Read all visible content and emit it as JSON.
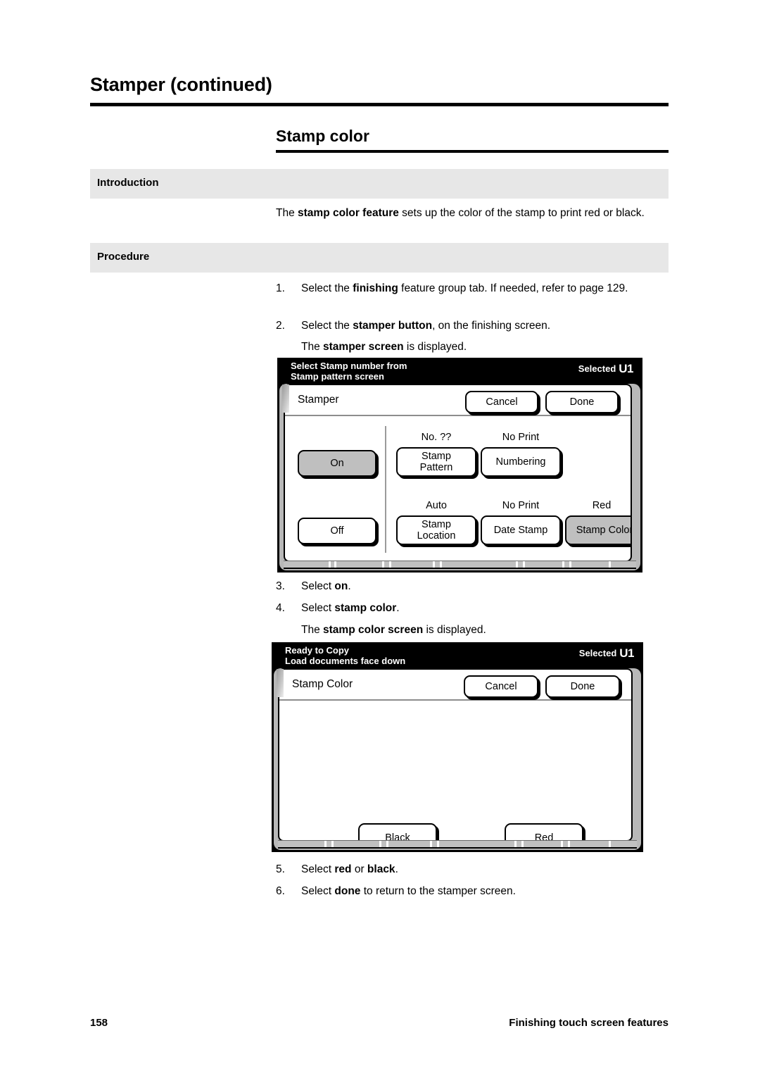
{
  "header": {
    "chapter_title": "Stamper (continued)",
    "section_title": "Stamp color"
  },
  "bands": {
    "introduction": "Introduction",
    "procedure": "Procedure"
  },
  "introduction": {
    "text_before": "The ",
    "text_bold": "stamp color feature",
    "text_after": " sets up the color of the stamp to print red or black."
  },
  "steps": [
    {
      "num": "1.",
      "parts": [
        {
          "t": "Select the ",
          "b": false
        },
        {
          "t": "finishing",
          "b": true
        },
        {
          "t": " feature group tab.  If needed, refer to page 129.",
          "b": false
        }
      ]
    },
    {
      "num": "2.",
      "parts": [
        {
          "t": "Select the ",
          "b": false
        },
        {
          "t": "stamper button",
          "b": true
        },
        {
          "t": ", on the finishing screen.",
          "b": false
        }
      ]
    },
    {
      "num": "3.",
      "parts": [
        {
          "t": "Select ",
          "b": false
        },
        {
          "t": "on",
          "b": true
        },
        {
          "t": ".",
          "b": false
        }
      ]
    },
    {
      "num": "4.",
      "parts": [
        {
          "t": "Select ",
          "b": false
        },
        {
          "t": "stamp color",
          "b": true
        },
        {
          "t": ".",
          "b": false
        }
      ]
    },
    {
      "num": "5.",
      "parts": [
        {
          "t": "Select ",
          "b": false
        },
        {
          "t": "red",
          "b": true
        },
        {
          "t": " or ",
          "b": false
        },
        {
          "t": "black",
          "b": true
        },
        {
          "t": ".",
          "b": false
        }
      ]
    },
    {
      "num": "6.",
      "parts": [
        {
          "t": "Select ",
          "b": false
        },
        {
          "t": "done",
          "b": true
        },
        {
          "t": " to return to the stamper screen.",
          "b": false
        }
      ]
    }
  ],
  "substeps": {
    "after_step2": [
      {
        "t": "The ",
        "b": false
      },
      {
        "t": "stamper screen",
        "b": true
      },
      {
        "t": " is displayed.",
        "b": false
      }
    ],
    "after_step4": [
      {
        "t": "The ",
        "b": false
      },
      {
        "t": "stamp color screen",
        "b": true
      },
      {
        "t": " is displayed.",
        "b": false
      }
    ]
  },
  "panel_stamper": {
    "status_line1": "Select Stamp number from",
    "status_line2": "Stamp pattern screen",
    "status_selected_label": "Selected",
    "status_selected_value": "U1",
    "title": "Stamper",
    "cancel_label": "Cancel",
    "done_label": "Done",
    "on_label": "On",
    "off_label": "Off",
    "buttons_row1": [
      {
        "caption": "No. ??",
        "label_line1": "Stamp",
        "label_line2": "Pattern",
        "selected": false
      },
      {
        "caption": "No Print",
        "label_line1": "Numbering",
        "label_line2": "",
        "selected": false
      }
    ],
    "buttons_row2": [
      {
        "caption": "Auto",
        "label_line1": "Stamp",
        "label_line2": "Location",
        "selected": false
      },
      {
        "caption": "No Print",
        "label_line1": "Date Stamp",
        "label_line2": "",
        "selected": false
      },
      {
        "caption": "Red",
        "label_line1": "Stamp Color",
        "label_line2": "",
        "selected": true
      }
    ]
  },
  "panel_stamp_color": {
    "status_line1": "Ready to Copy",
    "status_line2": "Load documents face down",
    "status_selected_label": "Selected",
    "status_selected_value": "U1",
    "title": "Stamp Color",
    "cancel_label": "Cancel",
    "done_label": "Done",
    "black_label": "Black",
    "red_label": "Red"
  },
  "footer": {
    "page_number": "158",
    "running_foot": "Finishing touch screen features"
  },
  "colors": {
    "band_gray": "#e7e7e7",
    "button_selected_gray": "#bfbfbf",
    "bezel_gray": "#b8b8b8",
    "status_bar": "#000000"
  }
}
